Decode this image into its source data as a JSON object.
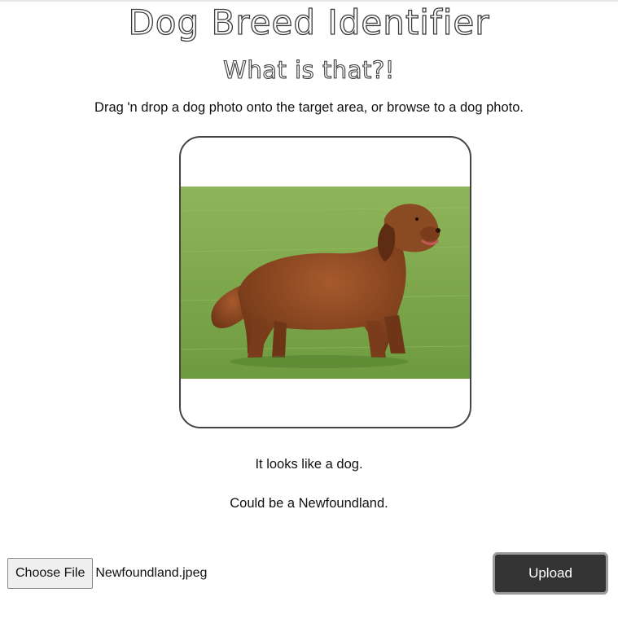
{
  "header": {
    "title": "Dog Breed Identifier",
    "subtitle": "What is that?!"
  },
  "instructions": "Drag 'n drop a dog photo onto the target area, or browse to a dog photo.",
  "drop_zone": {
    "image_subject": "newfoundland-dog-photo"
  },
  "results": {
    "line1": "It looks like a dog.",
    "line2": "Could be a Newfoundland."
  },
  "file_input": {
    "button_label": "Choose File",
    "selected_file": "Newfoundland.jpeg"
  },
  "upload": {
    "label": "Upload"
  },
  "colors": {
    "upload_bg": "#333333",
    "border": "#444444",
    "grass": "#7aa24a",
    "fur": "#8a4a22"
  }
}
